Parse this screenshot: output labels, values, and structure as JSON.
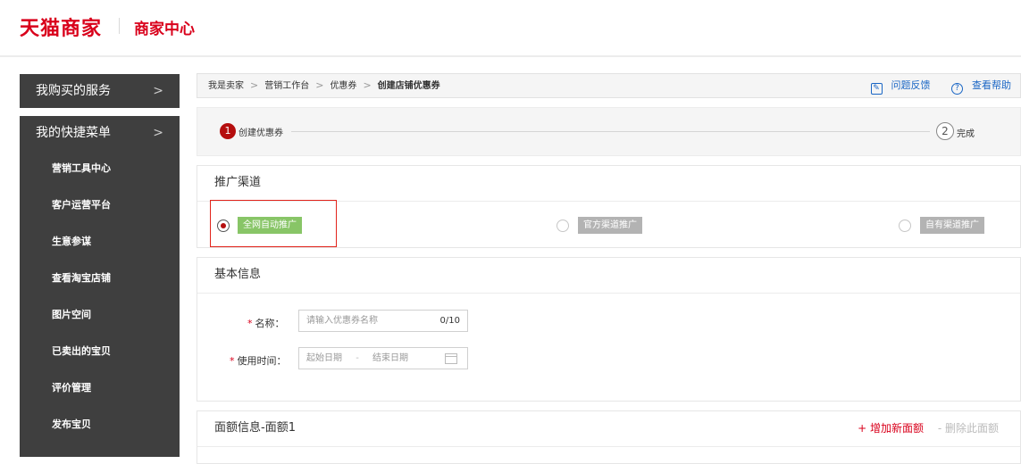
{
  "header": {
    "brand": "天猫商家",
    "subtitle": "商家中心"
  },
  "sidebar": {
    "services": "我购买的服务",
    "quick_menu": "我的快捷菜单",
    "items": [
      {
        "label": "营销工具中心"
      },
      {
        "label": "客户运营平台"
      },
      {
        "label": "生意参谋"
      },
      {
        "label": "查看淘宝店铺"
      },
      {
        "label": "图片空间"
      },
      {
        "label": "已卖出的宝贝"
      },
      {
        "label": "评价管理"
      },
      {
        "label": "发布宝贝"
      }
    ]
  },
  "breadcrumb": {
    "items": [
      "我是卖家",
      "营销工作台",
      "优惠券",
      "创建店铺优惠券"
    ],
    "feedback": "问题反馈",
    "help": "查看帮助"
  },
  "steps": [
    {
      "num": "1",
      "label": "创建优惠券"
    },
    {
      "num": "2",
      "label": "完成"
    }
  ],
  "channel": {
    "title": "推广渠道",
    "options": [
      {
        "label": "全网自动推广",
        "selected": true
      },
      {
        "label": "官方渠道推广",
        "selected": false
      },
      {
        "label": "自有渠道推广",
        "selected": false
      }
    ]
  },
  "basic": {
    "title": "基本信息",
    "name_label": "名称：",
    "name_placeholder": "请输入优惠券名称",
    "name_count": "0/10",
    "time_label": "使用时间：",
    "start_placeholder": "起始日期",
    "range_sep": "-",
    "end_placeholder": "结束日期"
  },
  "amount": {
    "title": "面额信息-面额1",
    "add": "+ 增加新面额",
    "delete": "- 删除此面额"
  },
  "colors": {
    "brand": "#d9001b",
    "sidebar": "#3f3f3f",
    "link": "#1a66c5",
    "chip_green": "#88c567",
    "chip_gray": "#b3b3b3"
  }
}
